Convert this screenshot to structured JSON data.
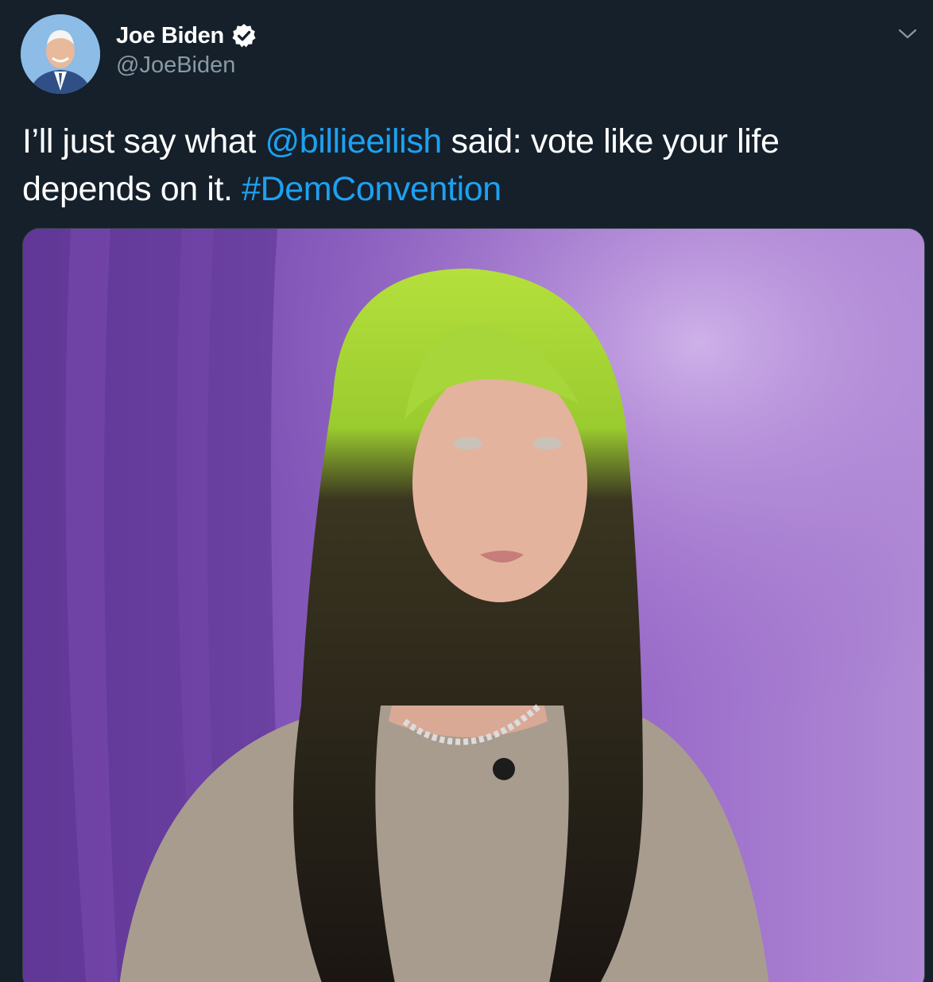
{
  "author": {
    "display_name": "Joe Biden",
    "handle": "@JoeBiden",
    "verified": true
  },
  "tweet": {
    "text_before": "I’ll just say what ",
    "mention": "@billieeilish",
    "text_middle": " said: vote like your life depends on it. ",
    "hashtag": "#DemConvention"
  },
  "icons": {
    "verified": "verified-badge-icon",
    "more": "chevron-down-icon"
  },
  "colors": {
    "background": "#15202b",
    "link": "#1da1f2",
    "secondary_text": "#8899a6"
  }
}
